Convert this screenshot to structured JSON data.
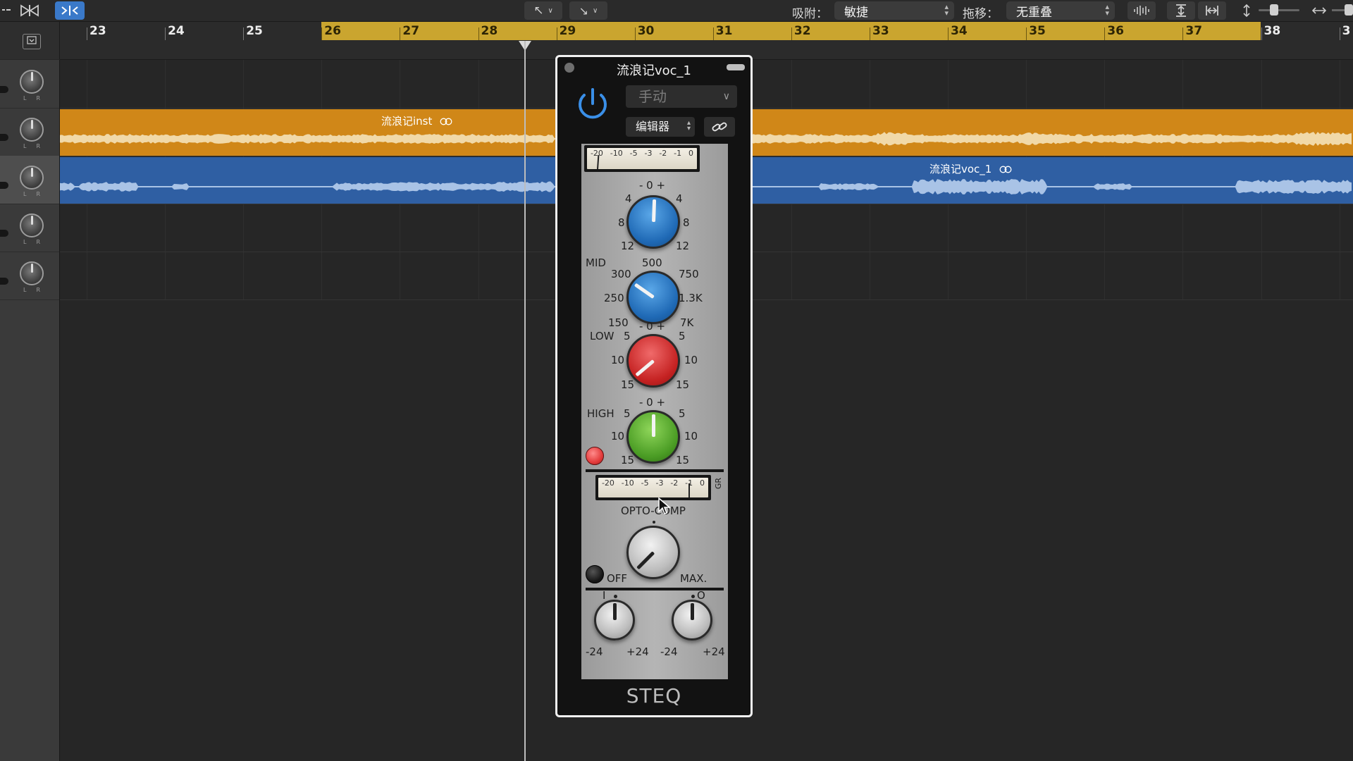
{
  "toolbar": {
    "snap_label": "吸附：",
    "snap_value": "敏捷",
    "drag_label": "拖移：",
    "drag_value": "无重叠"
  },
  "ruler": {
    "bars": [
      "23",
      "24",
      "25",
      "26",
      "27",
      "28",
      "29",
      "30",
      "31",
      "32",
      "33",
      "34",
      "35",
      "36",
      "37",
      "38",
      "3"
    ],
    "cycle_start_bar": 26,
    "cycle_end_bar": 38
  },
  "regions": {
    "inst": {
      "name": "流浪记inst",
      "color": "#d08718"
    },
    "voc": {
      "name": "流浪记voc_1",
      "color": "#2f5fa3"
    }
  },
  "plugin": {
    "title": "流浪记voc_1",
    "preset": "手动",
    "view": "编辑器",
    "name": "STEQ",
    "scale_labels": [
      "-20",
      "-10",
      "-5",
      "-3",
      "-2",
      "-1",
      "0"
    ],
    "gr_label": "GR",
    "top_knob": {
      "zero": "- 0 +",
      "left_top": "4",
      "right_top": "4",
      "left_mid": "8",
      "right_mid": "8",
      "left_bot": "12",
      "right_bot": "12"
    },
    "mid": {
      "label": "MID",
      "top": "500",
      "tl": "300",
      "tr": "750",
      "ml": "250",
      "mr": "1.3K",
      "bl": "150",
      "br": "7K"
    },
    "low": {
      "label": "LOW",
      "zero": "- 0 +",
      "t5l": "5",
      "t5r": "5",
      "l10": "10",
      "r10": "10",
      "b15l": "15",
      "b15r": "15"
    },
    "high": {
      "label": "HIGH",
      "zero": "- 0 +",
      "t5l": "5",
      "t5r": "5",
      "l10": "10",
      "r10": "10",
      "b15l": "15",
      "b15r": "15"
    },
    "comp": {
      "label": "OPTO-COMP",
      "off": "OFF",
      "max": "MAX."
    },
    "io": {
      "in_label": "I",
      "out_label": "O",
      "in_min": "-24",
      "in_max": "+24",
      "out_min": "-24",
      "out_max": "+24"
    }
  }
}
